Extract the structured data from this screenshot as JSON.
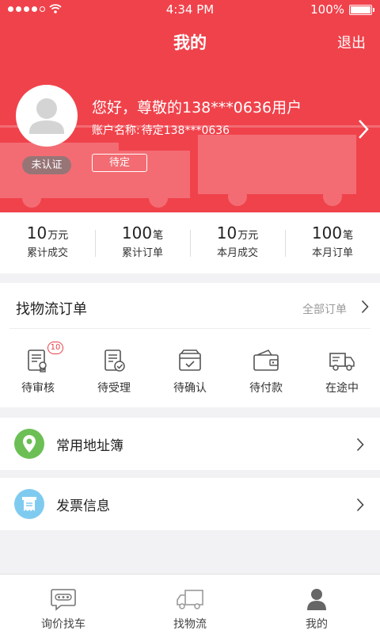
{
  "status_bar": {
    "time": "4:34 PM",
    "battery": "100%"
  },
  "header": {
    "title": "我的",
    "logout_label": "退出"
  },
  "profile": {
    "greeting": "您好，尊敬的138***0636用户",
    "account_label": "账户名称:",
    "account_value": "待定138***0636",
    "verification_badge": "未认证",
    "status_tag": "待定"
  },
  "stats": [
    {
      "value": "10",
      "unit": "万元",
      "label": "累计成交"
    },
    {
      "value": "100",
      "unit": "笔",
      "label": "累计订单"
    },
    {
      "value": "10",
      "unit": "万元",
      "label": "本月成交"
    },
    {
      "value": "100",
      "unit": "笔",
      "label": "本月订单"
    }
  ],
  "orders": {
    "title": "找物流订单",
    "all_label": "全部订单",
    "items": [
      {
        "label": "待审核",
        "icon": "review-document-icon",
        "badge": "10"
      },
      {
        "label": "待受理",
        "icon": "accept-document-icon"
      },
      {
        "label": "待确认",
        "icon": "confirm-box-icon"
      },
      {
        "label": "待付款",
        "icon": "wallet-icon"
      },
      {
        "label": "在途中",
        "icon": "truck-icon"
      }
    ]
  },
  "menu": [
    {
      "label": "常用地址簿",
      "icon": "location-pin-icon",
      "color": "#6cbf55"
    },
    {
      "label": "发票信息",
      "icon": "invoice-icon",
      "color": "#7fcbf0"
    }
  ],
  "tabbar": [
    {
      "label": "询价找车",
      "icon": "chat-bubble-icon"
    },
    {
      "label": "找物流",
      "icon": "truck-icon"
    },
    {
      "label": "我的",
      "icon": "person-icon"
    }
  ],
  "colors": {
    "brand_red": "#f0424b",
    "badge_red": "#e84049",
    "text_dark": "#222222",
    "text_gray": "#999999"
  }
}
